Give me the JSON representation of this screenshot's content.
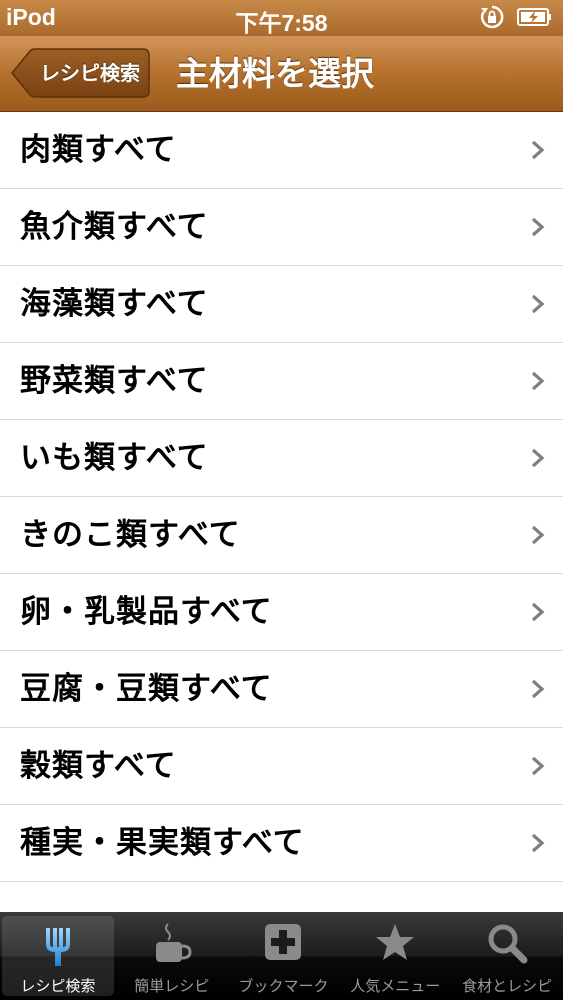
{
  "status_bar": {
    "carrier": "iPod",
    "time": "下午7:58"
  },
  "nav_bar": {
    "back_label": "レシピ検索",
    "title": "主材料を選択"
  },
  "list": {
    "items": [
      {
        "label": "肉類すべて"
      },
      {
        "label": "魚介類すべて"
      },
      {
        "label": "海藻類すべて"
      },
      {
        "label": "野菜類すべて"
      },
      {
        "label": "いも類すべて"
      },
      {
        "label": "きのこ類すべて"
      },
      {
        "label": "卵・乳製品すべて"
      },
      {
        "label": "豆腐・豆類すべて"
      },
      {
        "label": "穀類すべて"
      },
      {
        "label": "種実・果実類すべて"
      }
    ]
  },
  "tab_bar": {
    "tabs": [
      {
        "label": "レシピ検索",
        "icon": "fork-icon",
        "selected": true
      },
      {
        "label": "簡単レシピ",
        "icon": "cup-icon",
        "selected": false
      },
      {
        "label": "ブックマーク",
        "icon": "plus-box-icon",
        "selected": false
      },
      {
        "label": "人気メニュー",
        "icon": "star-icon",
        "selected": false
      },
      {
        "label": "食材とレシピ",
        "icon": "magnifier-icon",
        "selected": false
      }
    ]
  },
  "colors": {
    "nav_brown": "#b8742f",
    "tab_bar": "#1c1c1c",
    "selected_tab_icon": "#3aa0e8"
  }
}
